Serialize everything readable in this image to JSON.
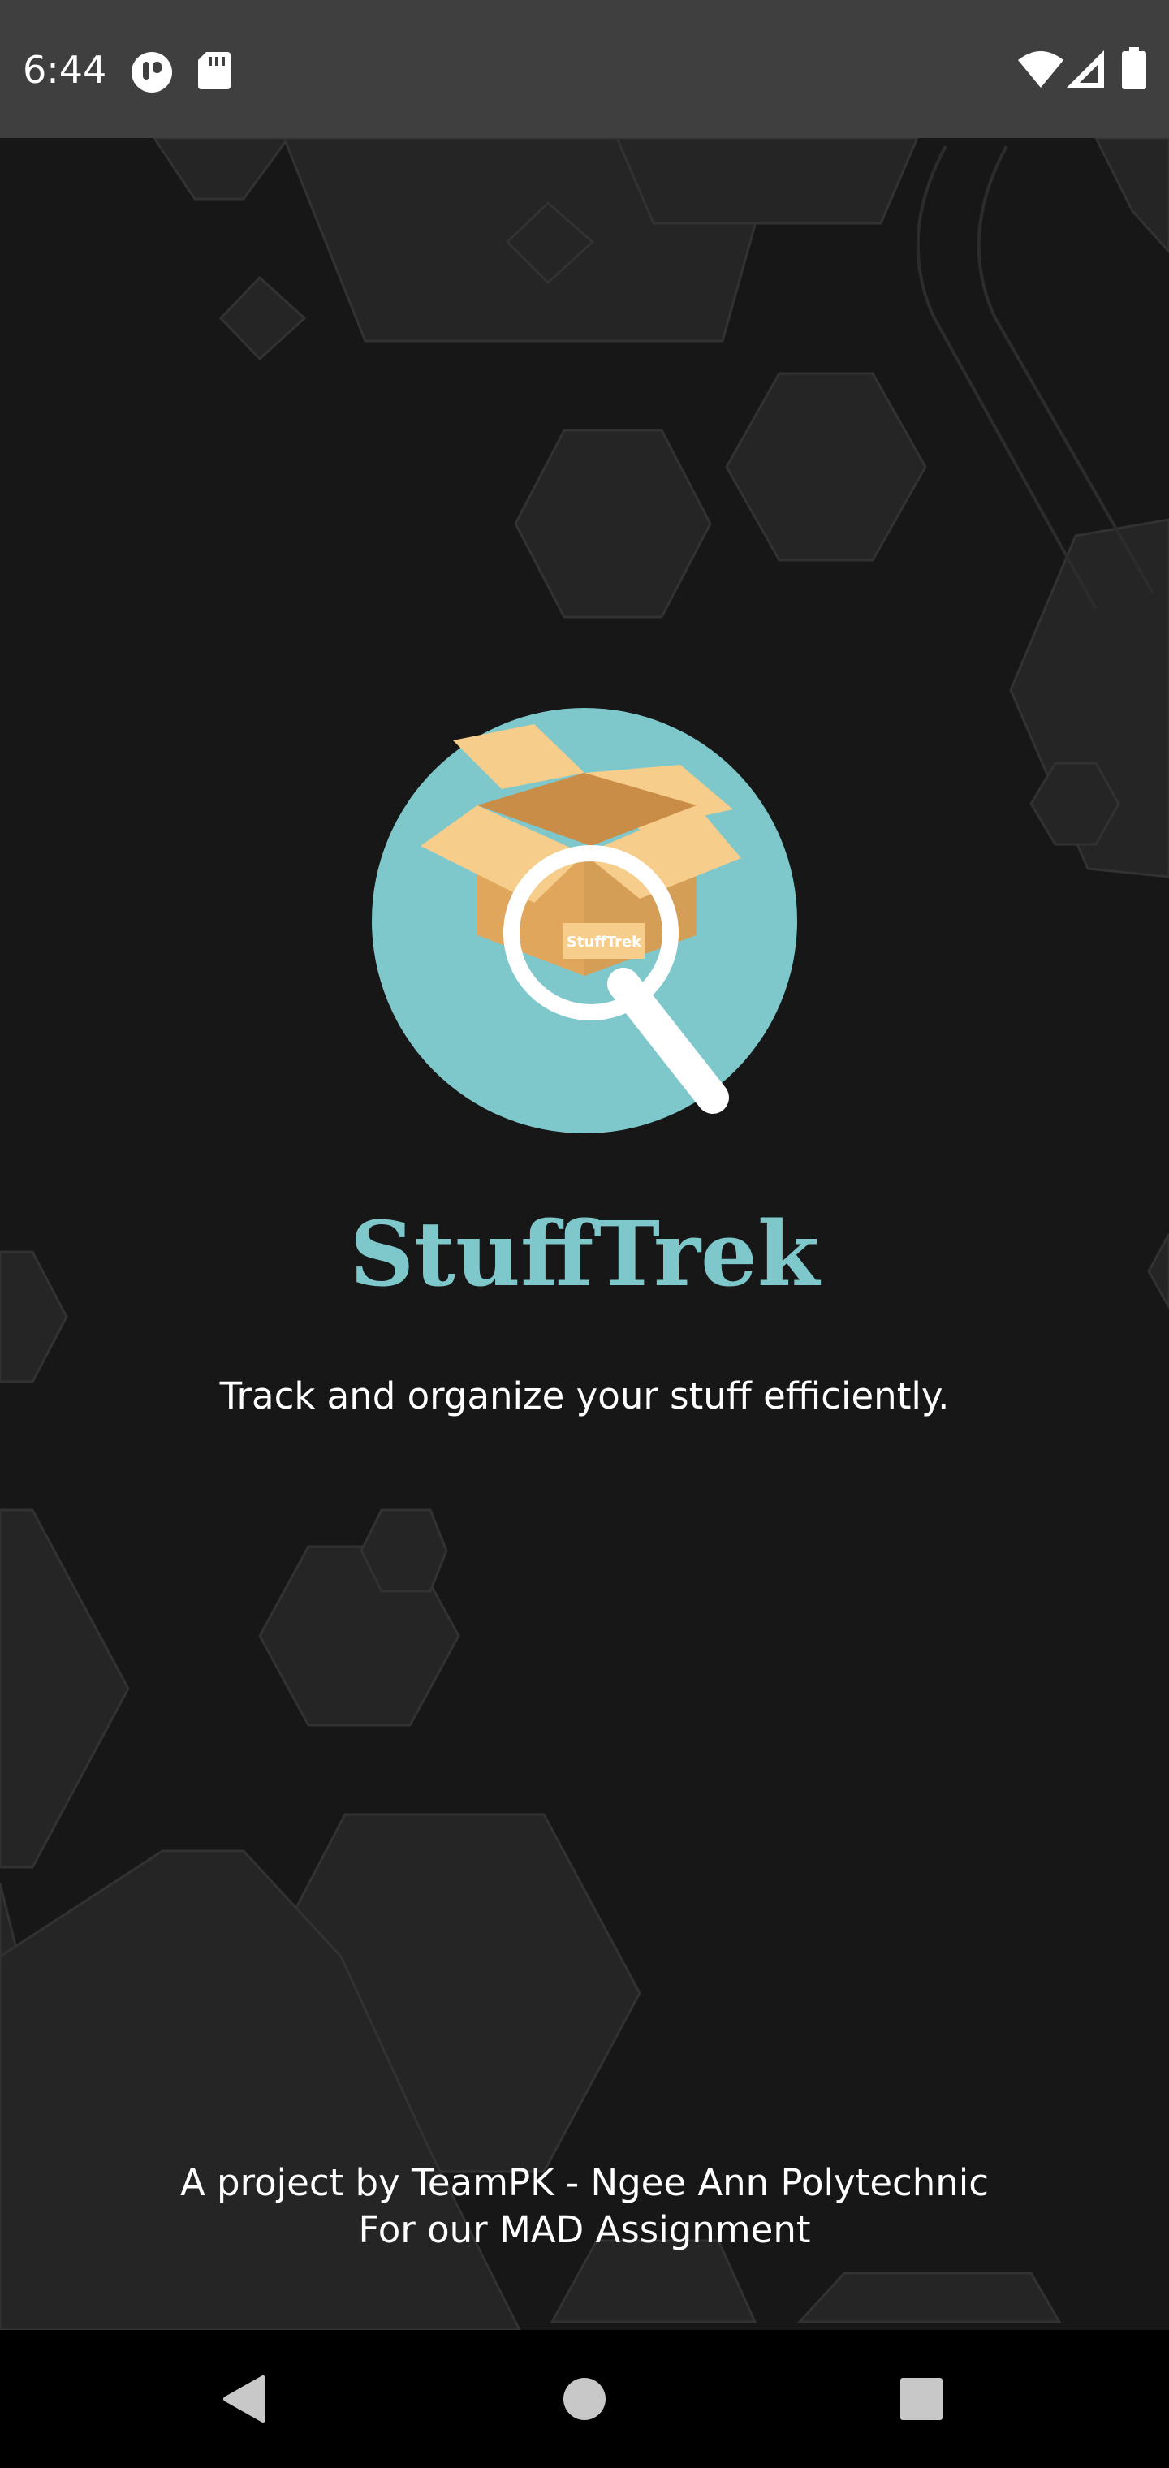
{
  "status_bar": {
    "time": "6:44",
    "left_icons": [
      "notification-app-icon",
      "sd-card-icon"
    ],
    "right_icons": [
      "wifi-icon",
      "cell-signal-icon",
      "battery-icon"
    ]
  },
  "app": {
    "name": "StuffTrek",
    "tagline": "Track and organize your stuff efficiently.",
    "logo_label": "StuffTrek",
    "credit_line_1": "A project by TeamPK - Ngee Ann Polytechnic",
    "credit_line_2": "For our MAD Assignment"
  },
  "nav_bar": {
    "buttons": [
      "back-icon",
      "home-icon",
      "recents-icon"
    ]
  },
  "colors": {
    "accent": "#7ec8cc",
    "background": "#171717",
    "status_bar": "#3f3f3f",
    "nav_bar": "#000000",
    "text": "#ffffff",
    "box_light": "#f6cd8a",
    "box_dark": "#d59e57"
  }
}
